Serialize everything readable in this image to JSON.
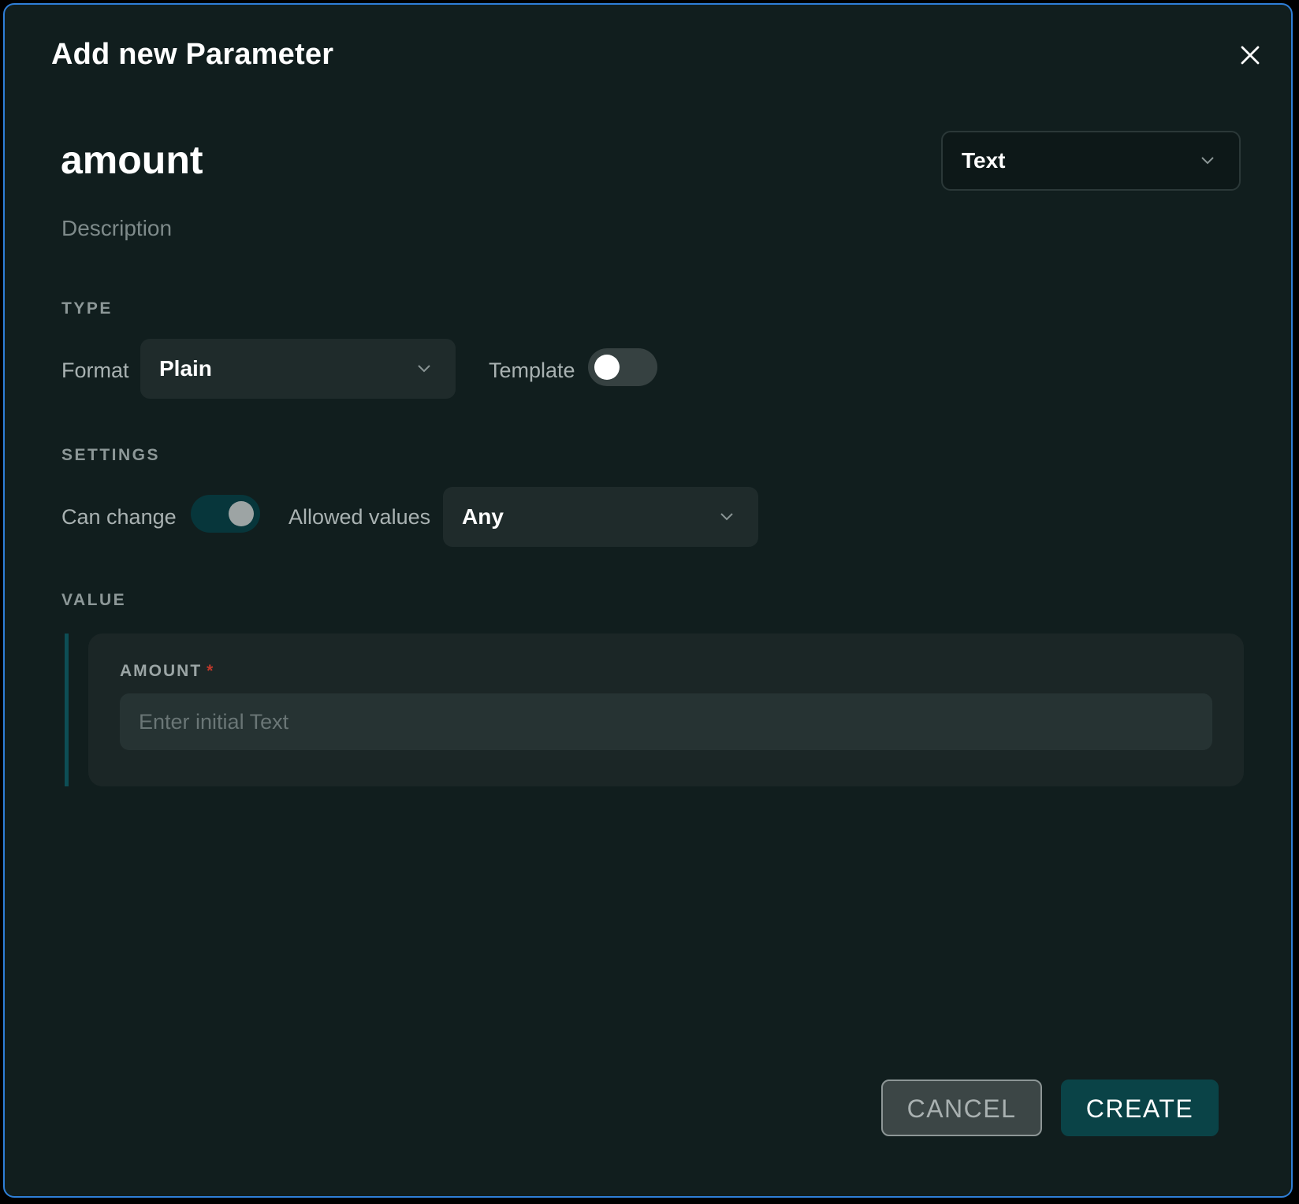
{
  "dialog": {
    "title": "Add new Parameter",
    "close_icon": "close-icon"
  },
  "parameter": {
    "name": "amount",
    "description_placeholder": "Description",
    "data_type": "Text"
  },
  "type_section": {
    "heading": "TYPE",
    "format_label": "Format",
    "format_value": "Plain",
    "template_label": "Template",
    "template_enabled": false
  },
  "settings_section": {
    "heading": "SETTINGS",
    "can_change_label": "Can change",
    "can_change_enabled": true,
    "allowed_values_label": "Allowed values",
    "allowed_values_value": "Any"
  },
  "value_section": {
    "heading": "VALUE",
    "field_label": "AMOUNT",
    "required_marker": "*",
    "input_value": "",
    "input_placeholder": "Enter initial Text"
  },
  "actions": {
    "cancel_label": "CANCEL",
    "create_label": "CREATE"
  },
  "colors": {
    "background": "#111e1e",
    "accent": "#0a4347",
    "border_highlight": "#2f7fd8",
    "required": "#c0392b"
  }
}
